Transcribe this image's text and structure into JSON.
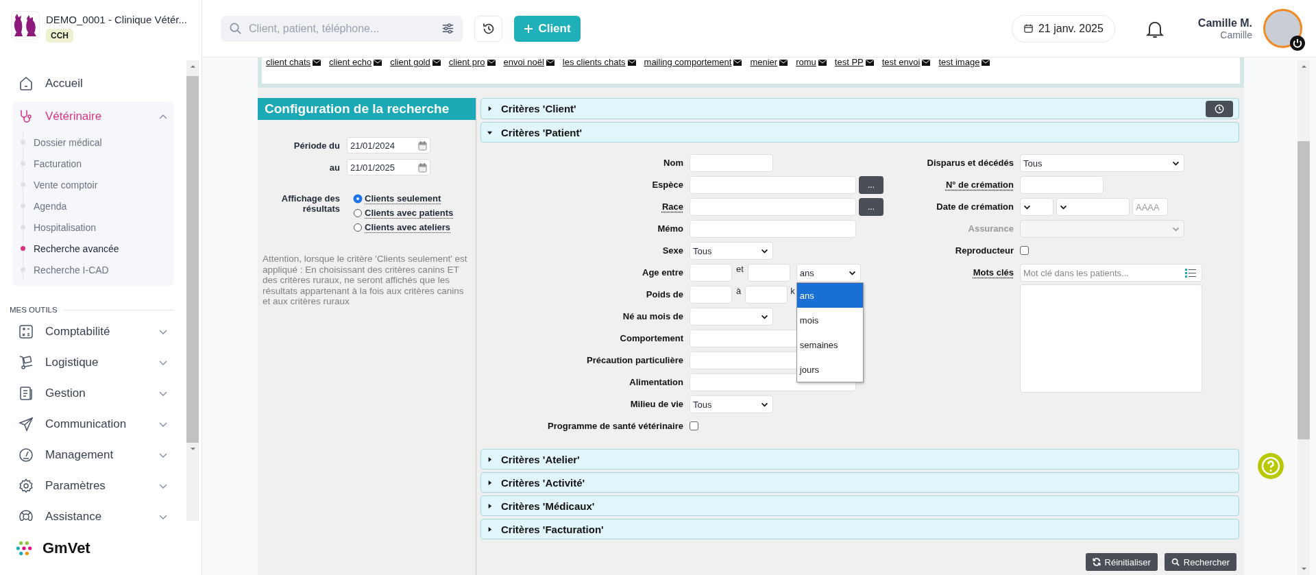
{
  "clinic": {
    "name": "DEMO_0001 - Clinique Vétér...",
    "badge": "CCH"
  },
  "nav": [
    {
      "label": "Accueil",
      "active": false
    },
    {
      "label": "Vétérinaire",
      "active": true,
      "expanded": true,
      "children": [
        {
          "label": "Dossier médical",
          "selected": false
        },
        {
          "label": "Facturation",
          "selected": false
        },
        {
          "label": "Vente comptoir",
          "selected": false
        },
        {
          "label": "Agenda",
          "selected": false
        },
        {
          "label": "Hospitalisation",
          "selected": false
        },
        {
          "label": "Recherche avancée",
          "selected": true
        },
        {
          "label": "Recherche I-CAD",
          "selected": false
        }
      ]
    }
  ],
  "tools_heading": "MES OUTILS",
  "tools": [
    {
      "label": "Comptabilité",
      "expanded": false
    },
    {
      "label": "Logistique",
      "expanded": false
    },
    {
      "label": "Gestion",
      "expanded": false
    },
    {
      "label": "Communication",
      "expanded": false
    },
    {
      "label": "Management",
      "expanded": false
    },
    {
      "label": "Paramètres",
      "expanded": false
    },
    {
      "label": "Assistance",
      "expanded": false
    }
  ],
  "brand": "GmVet",
  "header": {
    "search_placeholder": "Client, patient, téléphone...",
    "new_button": "Client",
    "date": "21 janv. 2025",
    "user_name": "Camille M.",
    "user_sub": "Camille"
  },
  "mailing_tags": [
    "client chats",
    "client echo",
    "client gold",
    "client pro",
    "envoi noël",
    "les clients chats",
    "mailing comportement",
    "menier",
    "romu",
    "test PP",
    "test envoi",
    "test image "
  ],
  "config": {
    "title": "Configuration de la recherche",
    "period_from_label": "Période du",
    "period_from": "21/01/2024",
    "period_to_label": "au",
    "period_to": "21/01/2025",
    "display_label": "Affichage des résultats",
    "display_options": [
      {
        "label": "Clients seulement",
        "selected": true
      },
      {
        "label": "Clients avec patients",
        "selected": false
      },
      {
        "label": "Clients avec ateliers",
        "selected": false
      }
    ],
    "note": "Attention, lorsque le critère 'Clients seulement' est appliqué : En choisissant des critères canins ET des critères ruraux, ne seront affichés que les résultats appartenant à la fois aux critères canins et aux critères ruraux"
  },
  "sections": [
    {
      "title": "Critères 'Client'",
      "expanded": false,
      "has_history": true
    },
    {
      "title": "Critères 'Patient'",
      "expanded": true,
      "has_history": false,
      "form": {
        "left": [
          {
            "kind": "text",
            "label": "Nom",
            "hint": false
          },
          {
            "kind": "lookup",
            "label": "Espèce",
            "hint": false,
            "button": "..."
          },
          {
            "kind": "lookup",
            "label": "Race",
            "hint": true,
            "button": "..."
          },
          {
            "kind": "wide",
            "label": "Mémo",
            "hint": false
          },
          {
            "kind": "select",
            "label": "Sexe",
            "hint": false,
            "value": "Tous"
          },
          {
            "kind": "age",
            "label": "Age entre",
            "hint": false,
            "separator": "et",
            "unit": "ans",
            "expanded": true,
            "options": [
              {
                "label": "ans",
                "selected": true
              },
              {
                "label": "mois",
                "selected": false
              },
              {
                "label": "semaines",
                "selected": false
              },
              {
                "label": "jours",
                "selected": false
              }
            ]
          },
          {
            "kind": "range",
            "label": "Poids de",
            "hint": false,
            "separator": "à",
            "unit": "k"
          },
          {
            "kind": "select",
            "label": "Né au mois de",
            "hint": false
          },
          {
            "kind": "wide",
            "label": "Comportement",
            "hint": false
          },
          {
            "kind": "wide",
            "label": "Précaution particulière",
            "hint": false
          },
          {
            "kind": "wide",
            "label": "Alimentation",
            "hint": false
          },
          {
            "kind": "select",
            "label": "Milieu de vie",
            "hint": false,
            "value": "Tous"
          },
          {
            "kind": "checkbox",
            "label": "Programme de santé vétérinaire",
            "hint": false,
            "checked": false
          }
        ],
        "right": [
          {
            "kind": "wide_select",
            "label": "Disparus et décédés",
            "hint": false,
            "disabled": false,
            "value": "Tous"
          },
          {
            "kind": "text",
            "label": "N° de crémation",
            "hint": true,
            "disabled": false
          },
          {
            "kind": "date_parts",
            "label": "Date de crémation",
            "hint": false,
            "disabled": false,
            "placeholder": "AAAA"
          },
          {
            "kind": "wide_select",
            "label": "Assurance",
            "hint": false,
            "disabled": true
          },
          {
            "kind": "checkbox",
            "label": "Reproducteur",
            "hint": false,
            "disabled": false,
            "checked": false
          },
          {
            "kind": "keywords",
            "label": "Mots clés",
            "hint": true,
            "disabled": false,
            "placeholder": "Mot clé dans les patients..."
          }
        ]
      }
    },
    {
      "title": "Critères 'Atelier'",
      "expanded": false,
      "has_history": false
    },
    {
      "title": "Critères 'Activité'",
      "expanded": false,
      "has_history": false
    },
    {
      "title": "Critères 'Médicaux'",
      "expanded": false,
      "has_history": false
    },
    {
      "title": "Critères 'Facturation'",
      "expanded": false,
      "has_history": false
    }
  ],
  "buttons": [
    {
      "label": "Réinitialiser"
    },
    {
      "label": "Rechercher"
    }
  ]
}
